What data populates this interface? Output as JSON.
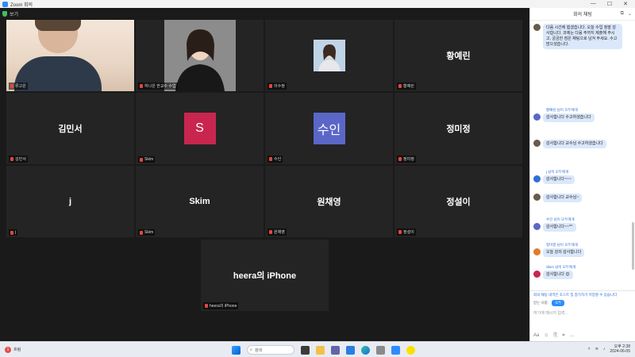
{
  "window": {
    "title": "Zoom 회의"
  },
  "meeting": {
    "info_label": "보기"
  },
  "tiles": [
    {
      "name": "",
      "label": "류고은",
      "type": "self"
    },
    {
      "name": "",
      "label": "하나은 한교수 수업",
      "type": "photo"
    },
    {
      "name": "",
      "label": "이수정",
      "type": "photo2"
    },
    {
      "name": "황예린",
      "label": "황예린",
      "type": "name"
    },
    {
      "name": "김민서",
      "label": "김민서",
      "type": "name"
    },
    {
      "name": "S",
      "label": "Skim",
      "type": "avatar",
      "color": "#c8264f"
    },
    {
      "name": "수인",
      "label": "수인",
      "type": "avatar",
      "color": "#5a67c7"
    },
    {
      "name": "정미정",
      "label": "정미정",
      "type": "name"
    },
    {
      "name": "j",
      "label": "j",
      "type": "name"
    },
    {
      "name": "Skim",
      "label": "Skim",
      "type": "name"
    },
    {
      "name": "원채영",
      "label": "원채영",
      "type": "name"
    },
    {
      "name": "정설이",
      "label": "정설이",
      "type": "name"
    },
    {
      "name": "heera의 iPhone",
      "label": "heera의 iPhone",
      "type": "name"
    }
  ],
  "chat": {
    "title": "회의 채팅",
    "messages": [
      {
        "meta": "",
        "text": "다음 시간에 뵙겠습니다. 오늘 수업 정말 감사합니다. 과제는 다음 주까지 제출해 주시고, 궁금한 점은 채팅으로 남겨 주세요. 수고 많으셨습니다.",
        "color": "#6b5a4a"
      },
      {
        "meta": "황예린 님이 모두에게",
        "text": "감사합니다 수고하셨습니다",
        "color": "#5a67c7"
      },
      {
        "meta": "",
        "text": "감사합니다 교수님 수고하셨습니다",
        "color": "#6b5a4a"
      },
      {
        "meta": "j 님이 모두에게",
        "text": "감사합니다~~~",
        "color": "#2d6fd6"
      },
      {
        "meta": "",
        "text": "감사합니다 교수님~",
        "color": "#6b5a4a"
      },
      {
        "meta": "수인 님이 모두에게",
        "text": "감사합니다~~^^",
        "color": "#5a67c7"
      },
      {
        "meta": "정미정 님이 모두에게",
        "text": "오늘 강의 감사합니다",
        "color": "#e37b2a"
      },
      {
        "meta": "Skim 님이 모두에게",
        "text": "감사합니다 😊",
        "color": "#c8264f"
      }
    ],
    "notice": "회의 채팅 내역은 호스트 및 참가자가 저장할 수 있습니다",
    "to_label": "받는 사람:",
    "to_value": "모두",
    "placeholder": "여기에 메시지 입력..."
  },
  "taskbar": {
    "weather": "흐림",
    "weather_badge": "1",
    "search": "검색",
    "time": "오후 2:38",
    "date": "2024-06-05"
  }
}
